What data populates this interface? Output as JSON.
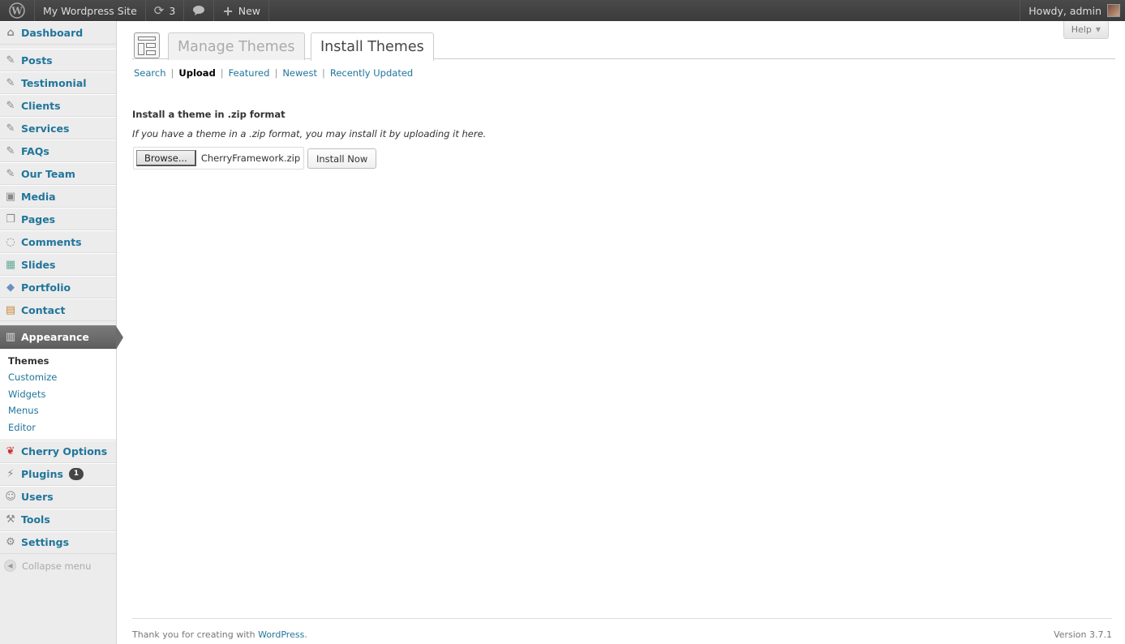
{
  "adminbar": {
    "site_name": "My Wordpress Site",
    "updates_count": "3",
    "new_label": "New",
    "howdy": "Howdy, admin"
  },
  "sidebar": {
    "items": [
      {
        "label": "Dashboard",
        "icon": "dashboard-icon"
      },
      {
        "label": "Posts",
        "icon": "pin-icon"
      },
      {
        "label": "Testimonial",
        "icon": "pin-icon"
      },
      {
        "label": "Clients",
        "icon": "pin-icon"
      },
      {
        "label": "Services",
        "icon": "pin-icon"
      },
      {
        "label": "FAQs",
        "icon": "pin-icon"
      },
      {
        "label": "Our Team",
        "icon": "pin-icon"
      },
      {
        "label": "Media",
        "icon": "media-icon"
      },
      {
        "label": "Pages",
        "icon": "pages-icon"
      },
      {
        "label": "Comments",
        "icon": "comments-icon"
      },
      {
        "label": "Slides",
        "icon": "slides-icon"
      },
      {
        "label": "Portfolio",
        "icon": "portfolio-icon"
      },
      {
        "label": "Contact",
        "icon": "contact-icon"
      },
      {
        "label": "Appearance",
        "icon": "appearance-icon"
      },
      {
        "label": "Cherry Options",
        "icon": "cherry-icon"
      },
      {
        "label": "Plugins",
        "icon": "plugins-icon",
        "badge": "1"
      },
      {
        "label": "Users",
        "icon": "users-icon"
      },
      {
        "label": "Tools",
        "icon": "tools-icon"
      },
      {
        "label": "Settings",
        "icon": "settings-icon"
      }
    ],
    "appearance_submenu": [
      "Themes",
      "Customize",
      "Widgets",
      "Menus",
      "Editor"
    ],
    "collapse_label": "Collapse menu"
  },
  "help_label": "Help",
  "tabs": [
    "Manage Themes",
    "Install Themes"
  ],
  "subnav": [
    "Search",
    "Upload",
    "Featured",
    "Newest",
    "Recently Updated"
  ],
  "upload": {
    "title": "Install a theme in .zip format",
    "description": "If you have a theme in a .zip format, you may install it by uploading it here.",
    "browse_label": "Browse...",
    "file_name": "CherryFramework.zip",
    "install_label": "Install Now"
  },
  "footer": {
    "thanks_prefix": "Thank you for creating with ",
    "thanks_link": "WordPress",
    "thanks_suffix": ".",
    "version": "Version 3.7.1"
  },
  "colors": {
    "link": "#21759b",
    "adminbar": "#464646",
    "sidebar_bg": "#ececec",
    "current_menu": "#6c6c6c"
  }
}
